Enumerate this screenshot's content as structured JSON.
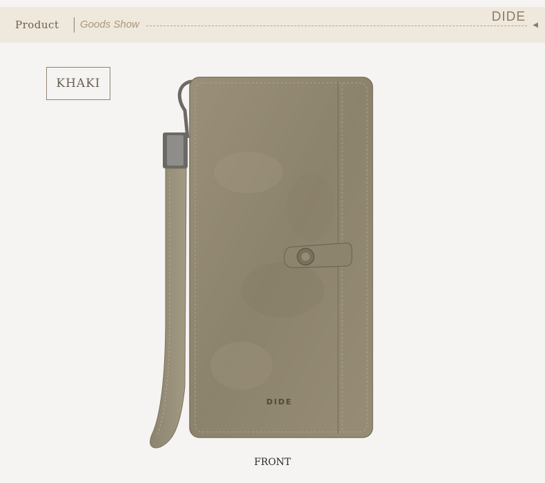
{
  "header": {
    "section_label": "Product",
    "subtitle": "Goods Show",
    "brand": "DIDE",
    "arrow_icon": "arrow-left-icon"
  },
  "product": {
    "color_label": "KHAKI",
    "wallet_logo": "DIDE",
    "view_caption": "FRONT"
  },
  "colors": {
    "header_bg": "#efe8dc",
    "page_bg": "#f5f4f2",
    "wallet_main": "#8f8670",
    "wallet_dark": "#6d6552"
  }
}
